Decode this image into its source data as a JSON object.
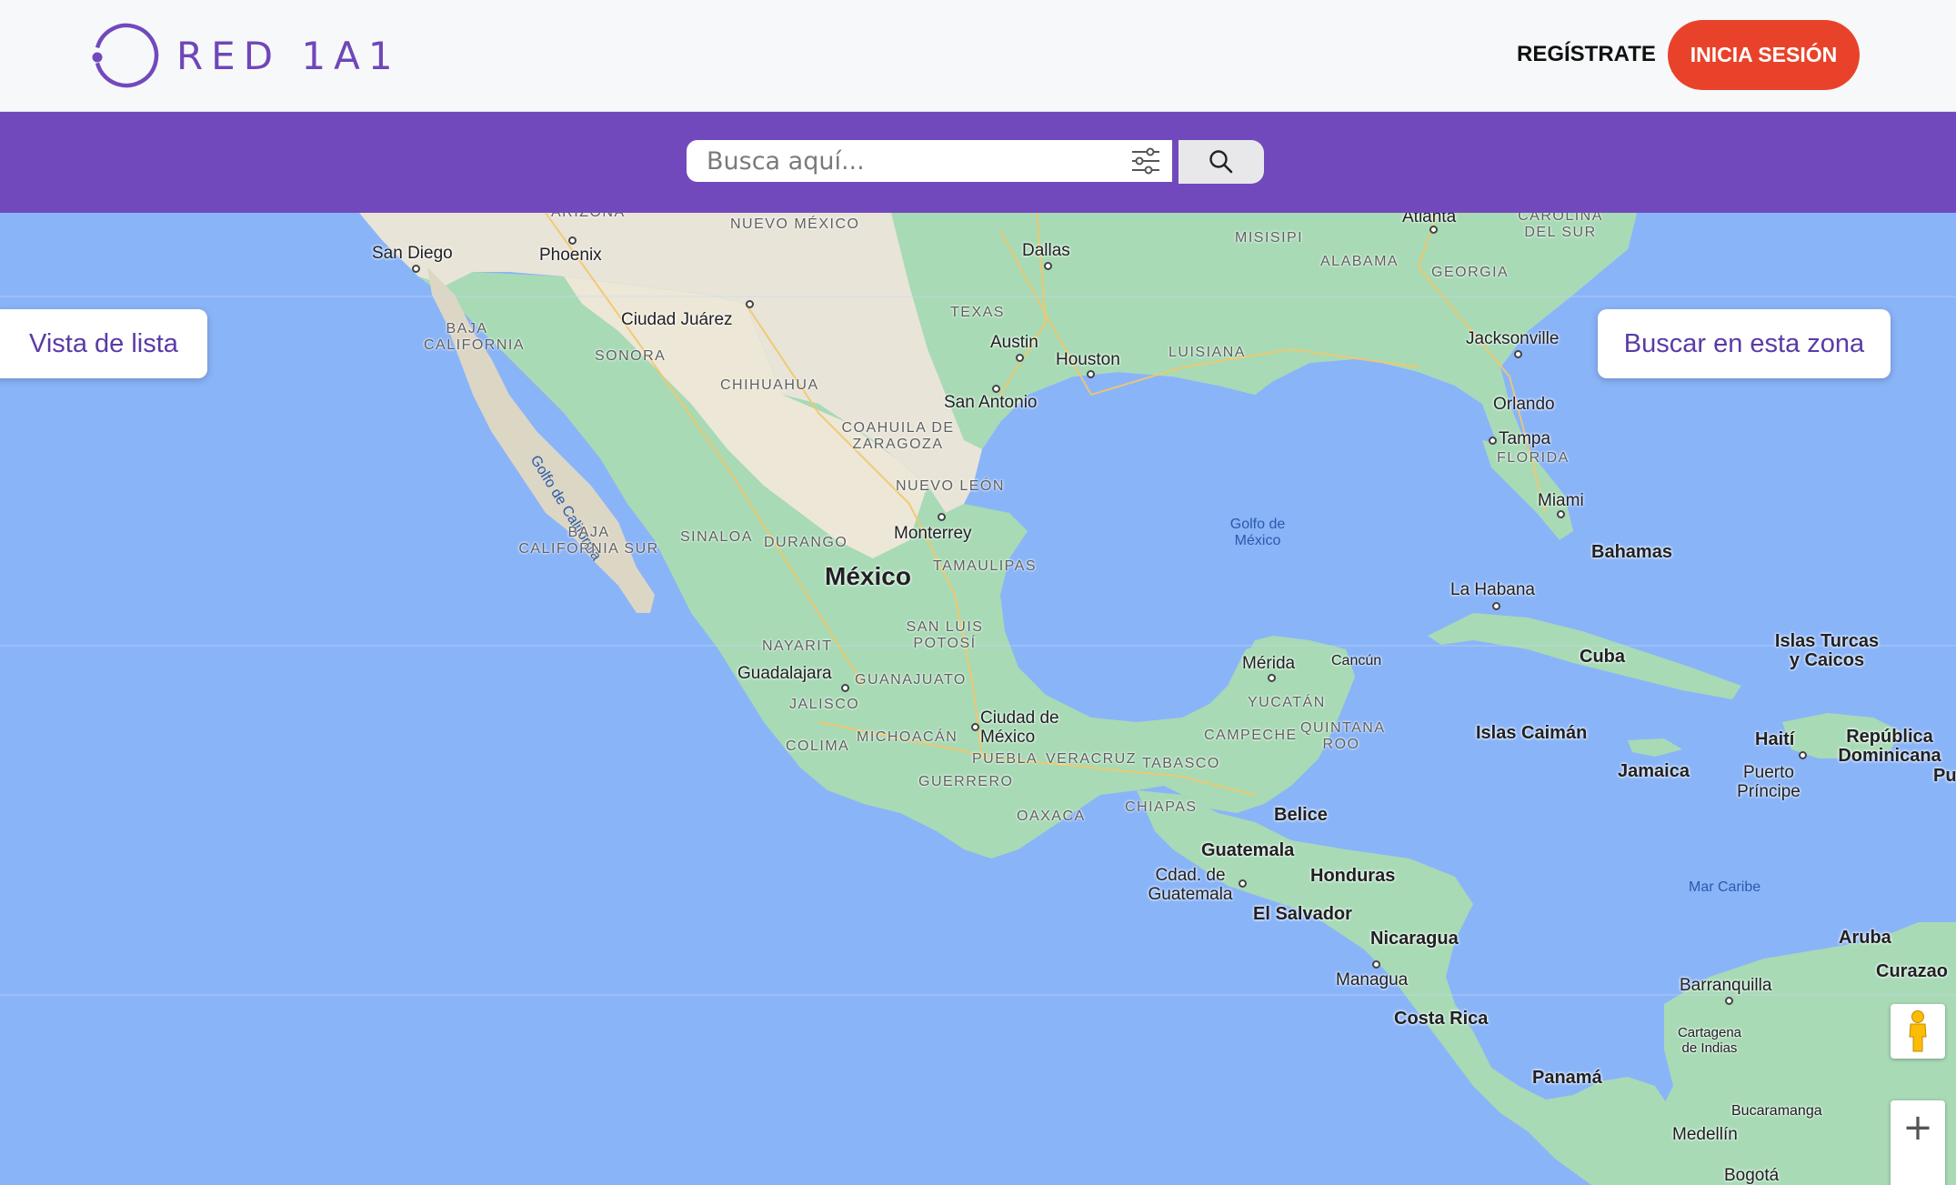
{
  "header": {
    "logo_text": "RED 1A1",
    "register_label": "REGÍSTRATE",
    "login_label": "INICIA SESIÓN"
  },
  "search": {
    "placeholder": "Busca aquí..."
  },
  "map_controls": {
    "list_view_label": "Vista de lista",
    "search_zone_label": "Buscar en esta zona",
    "zoom_in_label": "+"
  },
  "colors": {
    "brand_purple": "#7249bd",
    "accent_orange": "#e8432a",
    "water": "#8ab4f8",
    "land": "#a8dab5"
  },
  "map_labels": {
    "san_diego": "San Diego",
    "phoenix": "Phoenix",
    "ciudad_juarez": "Ciudad Juárez",
    "dallas": "Dallas",
    "atlanta": "Atlanta",
    "austin": "Austin",
    "houston": "Houston",
    "san_antonio": "San Antonio",
    "jacksonville": "Jacksonville",
    "orlando": "Orlando",
    "tampa": "Tampa",
    "miami": "Miami",
    "monterrey": "Monterrey",
    "mexico": "México",
    "guadalajara": "Guadalajara",
    "cdmx": "Ciudad de México",
    "merida": "Mérida",
    "cancun": "Cancún",
    "la_habana": "La Habana",
    "bahamas": "Bahamas",
    "cuba": "Cuba",
    "islas_turcas": "Islas Turcas y Caicos",
    "islas_caiman": "Islas Caimán",
    "jamaica": "Jamaica",
    "haiti": "Haití",
    "puerto_principe": "Puerto Príncipe",
    "rep_dominicana": "República Dominicana",
    "puerto": "Puert",
    "belice": "Belice",
    "guatemala": "Guatemala",
    "cdad_guatemala": "Cdad. de Guatemala",
    "honduras": "Honduras",
    "el_salvador": "El Salvador",
    "nicaragua": "Nicaragua",
    "managua": "Managua",
    "costa_rica": "Costa Rica",
    "panama": "Panamá",
    "aruba": "Aruba",
    "curazao": "Curazao",
    "barranquilla": "Barranquilla",
    "cartagena": "Cartagena de Indias",
    "bucaramanga": "Bucaramanga",
    "medellin": "Medellín",
    "bogota": "Bogotá",
    "golfo_mexico": "Golfo de México",
    "golfo_california": "Golfo de California",
    "mar_caribe": "Mar Caribe",
    "arizona": "ARIZONA",
    "nuevo_mexico": "NUEVO MÉXICO",
    "texas": "TEXAS",
    "misisipi": "MISISIPI",
    "alabama": "ALABAMA",
    "georgia": "GEORGIA",
    "carolina_sur": "CAROLINA DEL SUR",
    "luisiana": "LUISIANA",
    "florida": "FLORIDA",
    "baja_california": "BAJA CALIFORNIA",
    "sonora": "SONORA",
    "chihuahua": "CHIHUAHUA",
    "coahuila": "COAHUILA DE ZARAGOZA",
    "nuevo_leon": "NUEVO LEÓN",
    "baja_california_sur": "BAJA CALIFORNIA SUR",
    "sinaloa": "SINALOA",
    "durango": "DURANGO",
    "tamaulipas": "TAMAULIPAS",
    "nayarit": "NAYARIT",
    "san_luis": "SAN LUIS POTOSÍ",
    "guanajuato": "GUANAJUATO",
    "jalisco": "JALISCO",
    "colima": "COLIMA",
    "michoacan": "MICHOACÁN",
    "puebla": "PUEBLA",
    "veracruz": "VERACRUZ",
    "guerrero": "GUERRERO",
    "oaxaca": "OAXACA",
    "tabasco": "TABASCO",
    "chiapas": "CHIAPAS",
    "campeche": "CAMPECHE",
    "yucatan": "YUCATÁN",
    "quintana_roo": "QUINTANA ROO"
  }
}
